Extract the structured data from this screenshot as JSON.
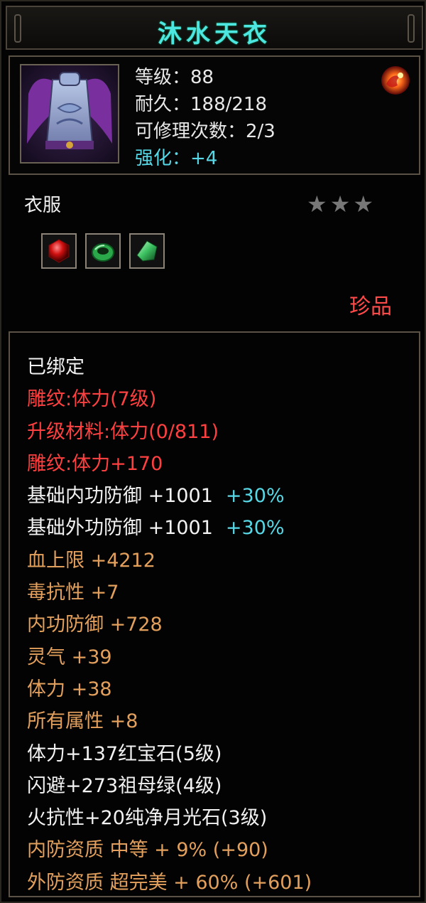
{
  "item": {
    "name": "沐水天衣",
    "portrait_icon": "armor-robe-icon",
    "stats": {
      "level": "等级：88",
      "durability": "耐久：188/218",
      "repairs": "可修理次数：2/3",
      "enhance_label": "强化：",
      "enhance_value": "+4"
    },
    "orb_icon": "fire-orb-icon",
    "category": "衣服",
    "stars": [
      "★",
      "★",
      "★"
    ],
    "gem_icons": [
      "ruby-gem-icon",
      "jade-ring-icon",
      "emerald-gem-icon"
    ],
    "quality": "珍品"
  },
  "properties": [
    {
      "text": "已绑定",
      "extra": "",
      "color": "#f2f2f2"
    },
    {
      "text": "雕纹:体力(7级)",
      "extra": "",
      "color": "#ff4040"
    },
    {
      "text": "升级材料:体力(0/811)",
      "extra": "",
      "color": "#ff4040"
    },
    {
      "text": "雕纹:体力+170",
      "extra": "",
      "color": "#ff4040"
    },
    {
      "text": "基础内功防御 +1001",
      "extra": "+30%",
      "color": "#f2f2f2"
    },
    {
      "text": "基础外功防御 +1001",
      "extra": "+30%",
      "color": "#f2f2f2"
    },
    {
      "text": "血上限  +4212",
      "extra": "",
      "color": "#e3a05c"
    },
    {
      "text": "毒抗性  +7",
      "extra": "",
      "color": "#e3a05c"
    },
    {
      "text": "内功防御  +728",
      "extra": "",
      "color": "#e3a05c"
    },
    {
      "text": "灵气  +39",
      "extra": "",
      "color": "#e3a05c"
    },
    {
      "text": "体力  +38",
      "extra": "",
      "color": "#e3a05c"
    },
    {
      "text": "所有属性  +8",
      "extra": "",
      "color": "#e3a05c"
    },
    {
      "text": "体力+137红宝石(5级)",
      "extra": "",
      "color": "#f2f2f2"
    },
    {
      "text": "闪避+273祖母绿(4级)",
      "extra": "",
      "color": "#f2f2f2"
    },
    {
      "text": "火抗性+20纯净月光石(3级)",
      "extra": "",
      "color": "#f2f2f2"
    },
    {
      "text": "内防资质  中等  +  9% (+90)",
      "extra": "",
      "color": "#e3a05c"
    },
    {
      "text": "外防资质  超完美  +  60% (+601)",
      "extra": "",
      "color": "#e3a05c"
    }
  ],
  "colors": {
    "title": "#4ee6e0",
    "cyan": "#57d8e6",
    "red": "#ff4040",
    "orange": "#e3a05c",
    "white": "#f2f2f2",
    "star": "#777777"
  }
}
